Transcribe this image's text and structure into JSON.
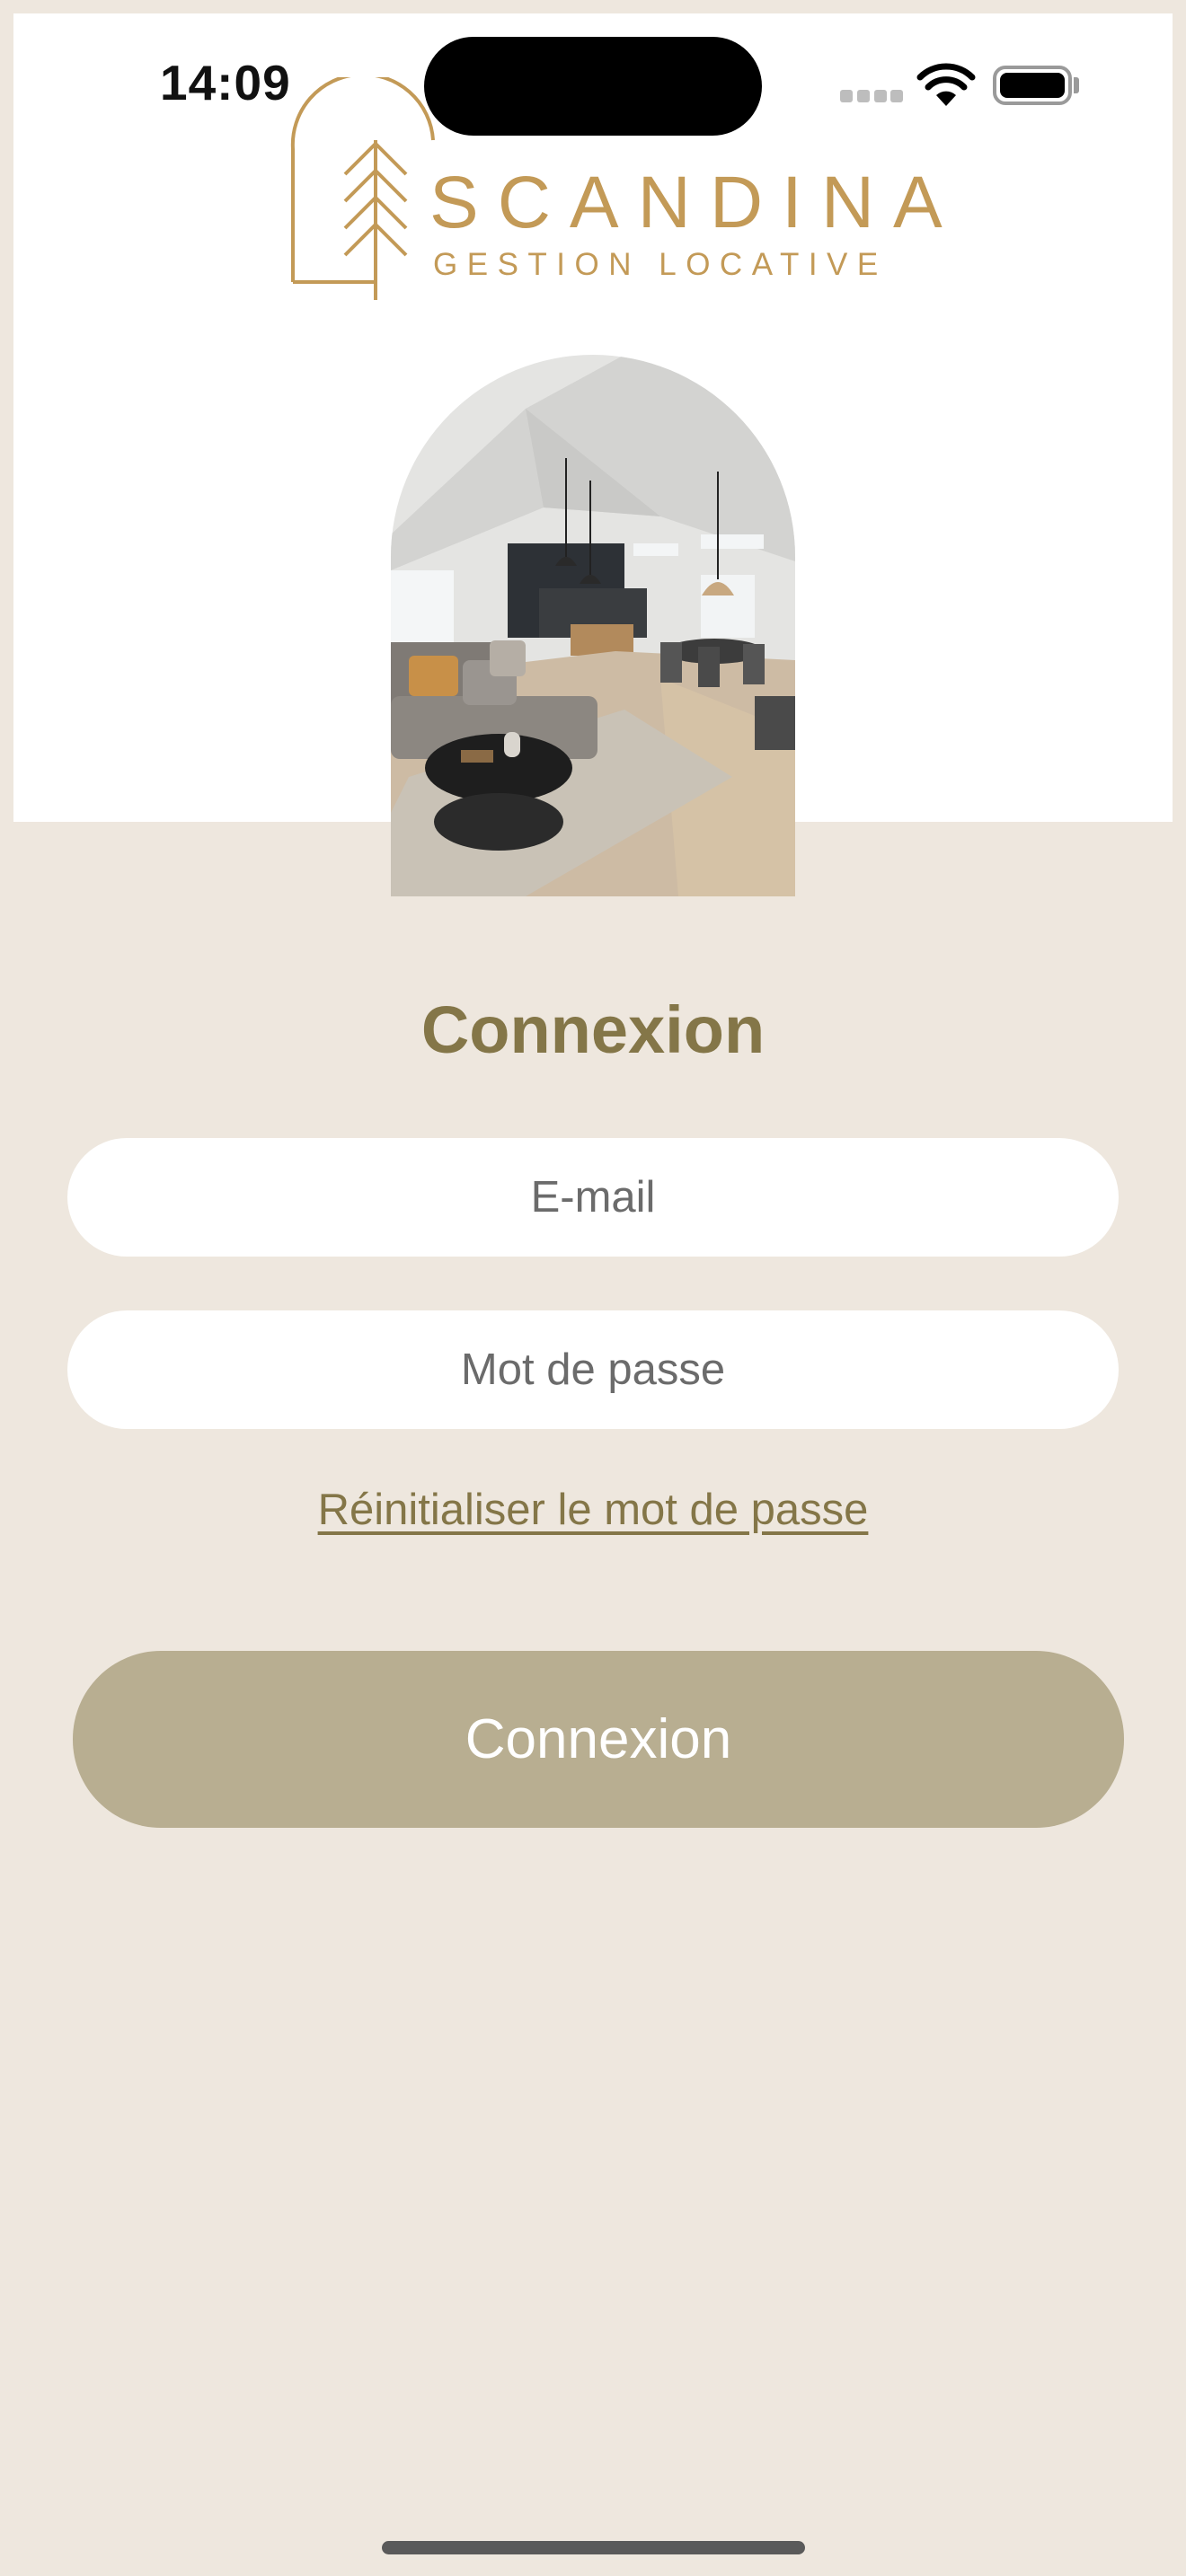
{
  "status_bar": {
    "time": "14:09"
  },
  "logo": {
    "wordmark": "SCANDINA",
    "subtitle": "GESTION LOCATIVE",
    "brand_color": "#C39A57",
    "icon": "pine-tree-arch-icon"
  },
  "hero": {
    "image": "living-room-interior-photo"
  },
  "login": {
    "title": "Connexion",
    "email_placeholder": "E-mail",
    "email_value": "",
    "password_placeholder": "Mot de passe",
    "password_value": "",
    "reset_link": "Réinitialiser le mot de passe",
    "submit_label": "Connexion"
  },
  "colors": {
    "background": "#EEE7DE",
    "accent_text": "#847648",
    "button": "#B8AE91"
  }
}
